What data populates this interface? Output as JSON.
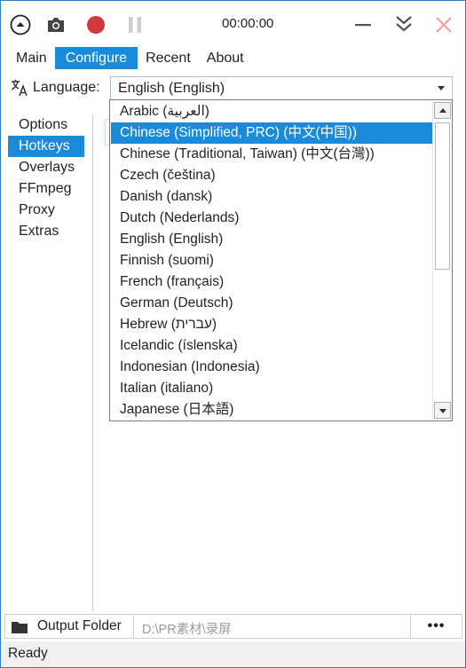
{
  "toolbar": {
    "timer": "00:00:00",
    "icons": [
      "collapse-toolbar-icon",
      "camera-icon",
      "record-icon",
      "pause-icon",
      "minimize-icon",
      "double-chevron-down-icon",
      "close-icon"
    ],
    "record_color": "#d0393e",
    "close_color": "#e8a0a0"
  },
  "tabs": [
    {
      "label": "Main",
      "active": false
    },
    {
      "label": "Configure",
      "active": true
    },
    {
      "label": "Recent",
      "active": false
    },
    {
      "label": "About",
      "active": false
    }
  ],
  "language": {
    "label": "Language:",
    "selected": "English (English)",
    "options": [
      "Arabic (العربية)",
      "Chinese (Simplified, PRC) (中文(中国))",
      "Chinese (Traditional, Taiwan) (中文(台灣))",
      "Czech (čeština)",
      "Danish (dansk)",
      "Dutch (Nederlands)",
      "English (English)",
      "Finnish (suomi)",
      "French (français)",
      "German (Deutsch)",
      "Hebrew (עברית)",
      "Icelandic (íslenska)",
      "Indonesian (Indonesia)",
      "Italian (italiano)",
      "Japanese (日本語)"
    ],
    "highlighted_index": 1
  },
  "nav": {
    "items": [
      {
        "label": "Options",
        "active": false
      },
      {
        "label": "Hotkeys",
        "active": true
      },
      {
        "label": "Overlays",
        "active": false
      },
      {
        "label": "FFmpeg",
        "active": false
      },
      {
        "label": "Proxy",
        "active": false
      },
      {
        "label": "Extras",
        "active": false
      }
    ]
  },
  "output": {
    "button_label": "Output Folder",
    "path_placeholder": "D:\\PR素材\\录屏",
    "more_label": "•••"
  },
  "status": {
    "text": "Ready"
  },
  "colors": {
    "accent": "#1a8ad9",
    "window_border": "#2e7ec6"
  }
}
